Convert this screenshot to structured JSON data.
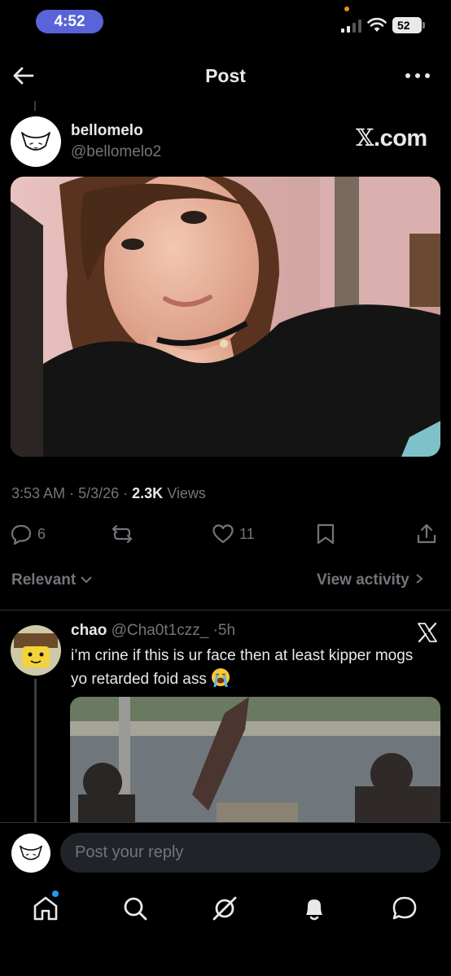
{
  "status_bar": {
    "time": "4:52",
    "battery": "52"
  },
  "header": {
    "title": "Post"
  },
  "post": {
    "author_name": "bellomelo",
    "author_handle": "@bellomelo2",
    "watermark_x": "𝕏",
    "watermark_text": ".com",
    "time": "3:53 AM",
    "date": "5/3/26",
    "views_count": "2.3K",
    "views_label": "Views",
    "sep": "·",
    "replies": "6",
    "likes": "11"
  },
  "filters": {
    "relevant": "Relevant",
    "view_activity": "View activity"
  },
  "reply": {
    "name": "chao",
    "handle": "@Cha0t1czz_",
    "sep": "·",
    "time": "5h",
    "text": "i’m crine if this is ur face then at least kipper mogs yo retarded foid ass"
  },
  "composer": {
    "placeholder": "Post your reply"
  },
  "colors": {
    "accent": "#1d9bf0",
    "muted": "#71767b",
    "background": "#000000",
    "time_pill": "#5a63d8"
  },
  "icons": [
    "back-arrow-icon",
    "more-icon",
    "reply-icon",
    "repost-icon",
    "like-icon",
    "bookmark-icon",
    "share-icon",
    "x-logo-icon",
    "home-icon",
    "search-icon",
    "grok-icon",
    "notifications-icon",
    "messages-icon"
  ]
}
